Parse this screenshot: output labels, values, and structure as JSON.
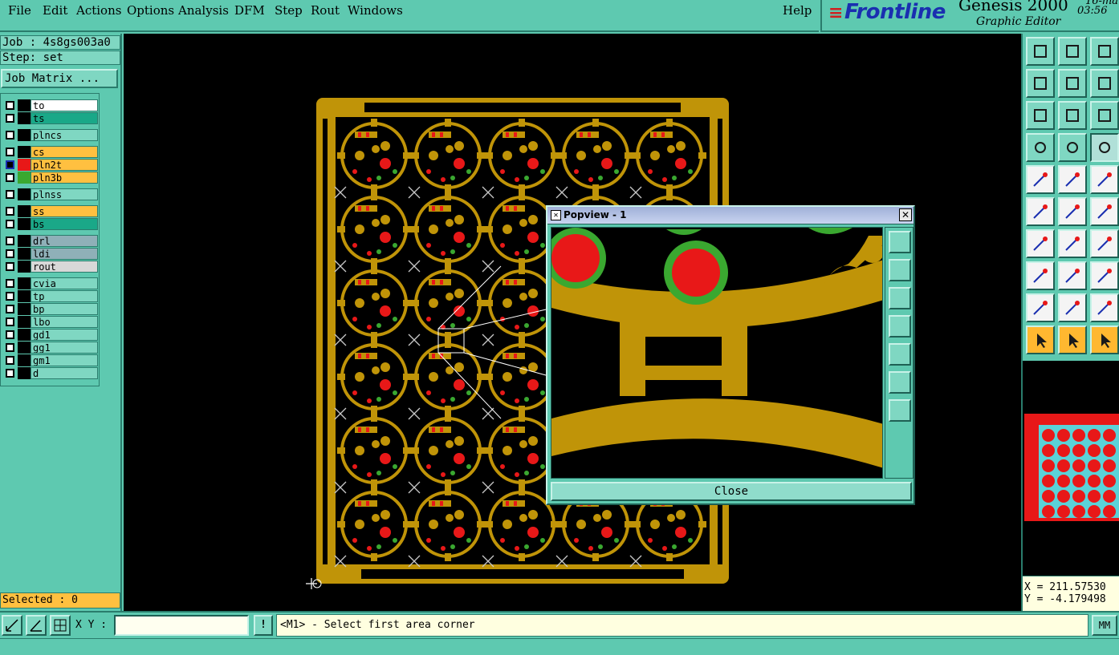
{
  "menubar": {
    "items": [
      "File",
      "Edit",
      "Actions",
      "Options",
      "Analysis",
      "DFM",
      "Step",
      "Rout",
      "Windows"
    ],
    "help": "Help"
  },
  "brand": {
    "logo": "Frontline",
    "product": "Genesis 2000",
    "subtitle": "Graphic Editor",
    "date": "16-mar",
    "time": "03:56"
  },
  "left_panel": {
    "job": "Job : 4s8gs003a0",
    "step": "Step: set",
    "job_matrix": "Job Matrix ...",
    "selected": "Selected : 0"
  },
  "layers": [
    {
      "name": "to",
      "bg": "#ffffff",
      "swatch": "#000000"
    },
    {
      "name": "ts",
      "bg": "#1aa888",
      "swatch": "#000000"
    },
    {
      "name": "plncs",
      "bg": "#7fd7c2",
      "swatch": "#000000"
    },
    {
      "name": "cs",
      "bg": "#ffc040",
      "swatch": "#000000"
    },
    {
      "name": "pln2t",
      "bg": "#ffc040",
      "swatch": "#e81818",
      "active": true
    },
    {
      "name": "pln3b",
      "bg": "#ffc040",
      "swatch": "#3aa830"
    },
    {
      "name": "plnss",
      "bg": "#7fd7c2",
      "swatch": "#000000"
    },
    {
      "name": "ss",
      "bg": "#ffc040",
      "swatch": "#000000"
    },
    {
      "name": "bs",
      "bg": "#1aa888",
      "swatch": "#000000"
    },
    {
      "name": "drl",
      "bg": "#8fb0b8",
      "swatch": "#000000"
    },
    {
      "name": "ldi",
      "bg": "#8fb0b8",
      "swatch": "#000000"
    },
    {
      "name": "rout",
      "bg": "#d8d8d8",
      "swatch": "#000000"
    },
    {
      "name": "cvia",
      "bg": "#7fd7c2",
      "swatch": "#000000"
    },
    {
      "name": "tp",
      "bg": "#7fd7c2",
      "swatch": "#000000"
    },
    {
      "name": "bp",
      "bg": "#7fd7c2",
      "swatch": "#000000"
    },
    {
      "name": "lbo",
      "bg": "#7fd7c2",
      "swatch": "#000000"
    },
    {
      "name": "gd1",
      "bg": "#7fd7c2",
      "swatch": "#000000"
    },
    {
      "name": "gg1",
      "bg": "#7fd7c2",
      "swatch": "#000000"
    },
    {
      "name": "gm1",
      "bg": "#7fd7c2",
      "swatch": "#000000"
    },
    {
      "name": "d",
      "bg": "#7fd7c2",
      "swatch": "#000000"
    }
  ],
  "popview": {
    "title": "Popview - 1",
    "close": "Close"
  },
  "coords": {
    "x": "X = 211.57530",
    "y": "Y = -4.179498"
  },
  "bottom": {
    "xy_label": "X Y :",
    "xy_value": "",
    "bang": "!",
    "prompt": "<M1> - Select first area corner",
    "units": "MM"
  },
  "palette": {
    "copper": "#c09408",
    "pad_red": "#e81818",
    "pad_green": "#3aa830",
    "panel": "#5ec9b0"
  }
}
